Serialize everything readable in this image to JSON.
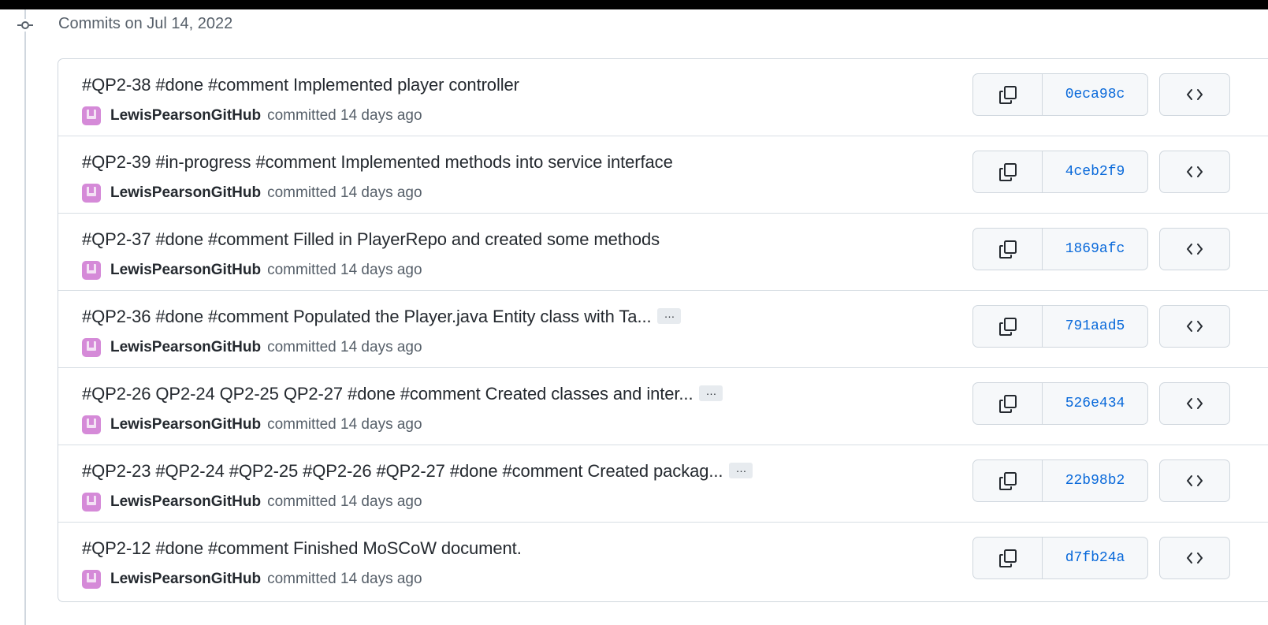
{
  "group": {
    "title": "Commits on Jul 14, 2022"
  },
  "icons": {
    "timeline": "git-commit-icon",
    "copy": "copy-icon",
    "browse": "code-icon",
    "avatar": "user-avatar"
  },
  "colors": {
    "sha_link": "#0969da",
    "avatar_bg": "#d58ad8",
    "border": "#d0d7de"
  },
  "commits": [
    {
      "title": "#QP2-38 #done #comment Implemented player controller",
      "has_ellipsis": false,
      "ellipsis_label": "",
      "author": "LewisPearsonGitHub",
      "action": "committed 14 days ago",
      "sha": "0eca98c"
    },
    {
      "title": "#QP2-39 #in-progress #comment Implemented methods into service interface",
      "has_ellipsis": false,
      "ellipsis_label": "",
      "author": "LewisPearsonGitHub",
      "action": "committed 14 days ago",
      "sha": "4ceb2f9"
    },
    {
      "title": "#QP2-37 #done #comment Filled in PlayerRepo and created some methods",
      "has_ellipsis": false,
      "ellipsis_label": "",
      "author": "LewisPearsonGitHub",
      "action": "committed 14 days ago",
      "sha": "1869afc"
    },
    {
      "title": "#QP2-36 #done #comment Populated the Player.java Entity class with Ta...",
      "has_ellipsis": true,
      "ellipsis_label": "…",
      "author": "LewisPearsonGitHub",
      "action": "committed 14 days ago",
      "sha": "791aad5"
    },
    {
      "title": "#QP2-26 QP2-24 QP2-25 QP2-27 #done #comment Created classes and inter...",
      "has_ellipsis": true,
      "ellipsis_label": "…",
      "author": "LewisPearsonGitHub",
      "action": "committed 14 days ago",
      "sha": "526e434"
    },
    {
      "title": "#QP2-23 #QP2-24 #QP2-25 #QP2-26 #QP2-27 #done #comment Created packag...",
      "has_ellipsis": true,
      "ellipsis_label": "…",
      "author": "LewisPearsonGitHub",
      "action": "committed 14 days ago",
      "sha": "22b98b2"
    },
    {
      "title": "#QP2-12 #done #comment Finished MoSCoW document.",
      "has_ellipsis": false,
      "ellipsis_label": "",
      "author": "LewisPearsonGitHub",
      "action": "committed 14 days ago",
      "sha": "d7fb24a"
    }
  ]
}
